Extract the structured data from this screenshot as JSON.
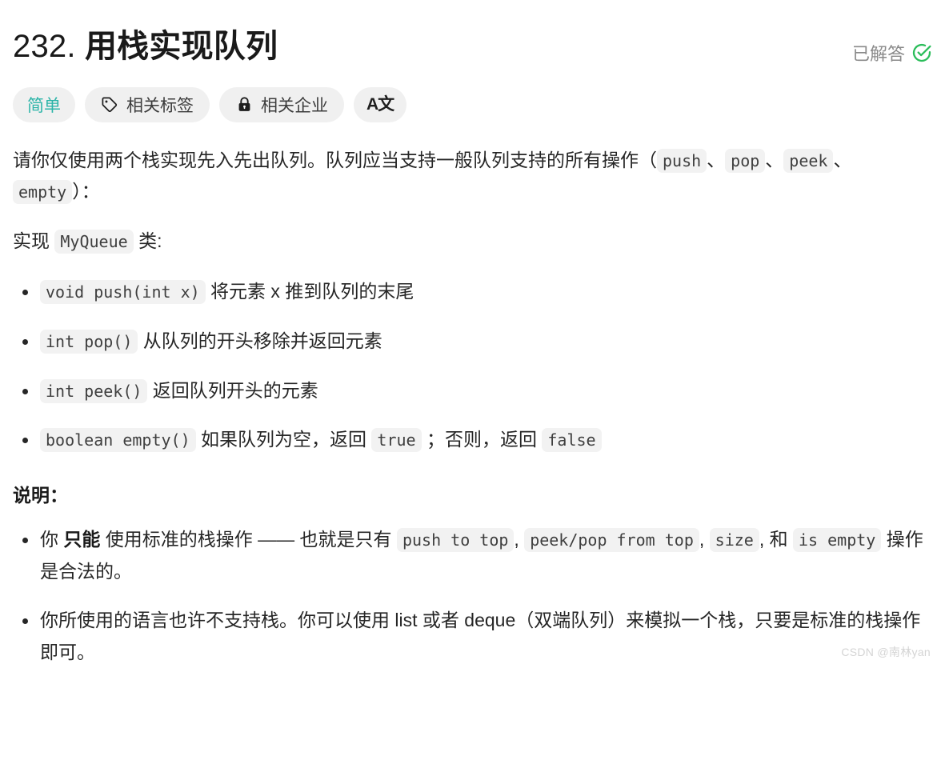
{
  "header": {
    "problem_number": "232.",
    "problem_title": "用栈实现队列",
    "status_text": "已解答",
    "status_icon": "check-circle-icon",
    "status_color": "#2bbd5a"
  },
  "pills": {
    "difficulty": {
      "label": "简单",
      "color": "#2cb4a8"
    },
    "tags": {
      "label": "相关标签",
      "icon": "tag-icon"
    },
    "companies": {
      "label": "相关企业",
      "icon": "lock-icon"
    },
    "translate": {
      "label": "A文",
      "icon": "translate-icon"
    }
  },
  "content": {
    "intro": {
      "part1": "请你仅使用两个栈实现先入先出队列。队列应当支持一般队列支持的所有操作（",
      "code1": "push",
      "sep1": "、",
      "code2": "pop",
      "sep2": "、",
      "code3": "peek",
      "sep3": "、",
      "code4": "empty",
      "part2": "）："
    },
    "implement": {
      "prefix": "实现 ",
      "code": "MyQueue",
      "suffix": " 类:"
    },
    "methods": [
      {
        "code": "void push(int x)",
        "text": " 将元素 x 推到队列的末尾"
      },
      {
        "code": "int pop()",
        "text": " 从队列的开头移除并返回元素"
      },
      {
        "code": "int peek()",
        "text": " 返回队列开头的元素"
      }
    ],
    "empty_method": {
      "code": "boolean empty()",
      "text1": " 如果队列为空，返回 ",
      "code_true": "true",
      "text2": " ；否则，返回 ",
      "code_false": "false"
    },
    "notes_title": "说明：",
    "note1": {
      "part1": "你 ",
      "bold": "只能",
      "part2": " 使用标准的栈操作 —— 也就是只有 ",
      "code1": "push to top",
      "sep1": ", ",
      "code2": "peek/pop from top",
      "sep2": ", ",
      "code3": "size",
      "sep3": ", 和 ",
      "code4": "is empty",
      "part3": " 操作是合法的。"
    },
    "note2": "你所使用的语言也许不支持栈。你可以使用 list 或者 deque（双端队列）来模拟一个栈，只要是标准的栈操作即可。"
  },
  "watermark": "CSDN @南林yan"
}
